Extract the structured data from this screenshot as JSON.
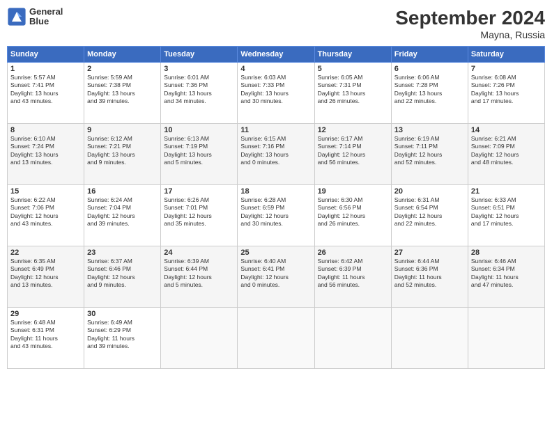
{
  "logo": {
    "line1": "General",
    "line2": "Blue"
  },
  "title": "September 2024",
  "subtitle": "Mayna, Russia",
  "weekdays": [
    "Sunday",
    "Monday",
    "Tuesday",
    "Wednesday",
    "Thursday",
    "Friday",
    "Saturday"
  ],
  "weeks": [
    [
      {
        "day": "1",
        "info": "Sunrise: 5:57 AM\nSunset: 7:41 PM\nDaylight: 13 hours\nand 43 minutes."
      },
      {
        "day": "2",
        "info": "Sunrise: 5:59 AM\nSunset: 7:38 PM\nDaylight: 13 hours\nand 39 minutes."
      },
      {
        "day": "3",
        "info": "Sunrise: 6:01 AM\nSunset: 7:36 PM\nDaylight: 13 hours\nand 34 minutes."
      },
      {
        "day": "4",
        "info": "Sunrise: 6:03 AM\nSunset: 7:33 PM\nDaylight: 13 hours\nand 30 minutes."
      },
      {
        "day": "5",
        "info": "Sunrise: 6:05 AM\nSunset: 7:31 PM\nDaylight: 13 hours\nand 26 minutes."
      },
      {
        "day": "6",
        "info": "Sunrise: 6:06 AM\nSunset: 7:28 PM\nDaylight: 13 hours\nand 22 minutes."
      },
      {
        "day": "7",
        "info": "Sunrise: 6:08 AM\nSunset: 7:26 PM\nDaylight: 13 hours\nand 17 minutes."
      }
    ],
    [
      {
        "day": "8",
        "info": "Sunrise: 6:10 AM\nSunset: 7:24 PM\nDaylight: 13 hours\nand 13 minutes."
      },
      {
        "day": "9",
        "info": "Sunrise: 6:12 AM\nSunset: 7:21 PM\nDaylight: 13 hours\nand 9 minutes."
      },
      {
        "day": "10",
        "info": "Sunrise: 6:13 AM\nSunset: 7:19 PM\nDaylight: 13 hours\nand 5 minutes."
      },
      {
        "day": "11",
        "info": "Sunrise: 6:15 AM\nSunset: 7:16 PM\nDaylight: 13 hours\nand 0 minutes."
      },
      {
        "day": "12",
        "info": "Sunrise: 6:17 AM\nSunset: 7:14 PM\nDaylight: 12 hours\nand 56 minutes."
      },
      {
        "day": "13",
        "info": "Sunrise: 6:19 AM\nSunset: 7:11 PM\nDaylight: 12 hours\nand 52 minutes."
      },
      {
        "day": "14",
        "info": "Sunrise: 6:21 AM\nSunset: 7:09 PM\nDaylight: 12 hours\nand 48 minutes."
      }
    ],
    [
      {
        "day": "15",
        "info": "Sunrise: 6:22 AM\nSunset: 7:06 PM\nDaylight: 12 hours\nand 43 minutes."
      },
      {
        "day": "16",
        "info": "Sunrise: 6:24 AM\nSunset: 7:04 PM\nDaylight: 12 hours\nand 39 minutes."
      },
      {
        "day": "17",
        "info": "Sunrise: 6:26 AM\nSunset: 7:01 PM\nDaylight: 12 hours\nand 35 minutes."
      },
      {
        "day": "18",
        "info": "Sunrise: 6:28 AM\nSunset: 6:59 PM\nDaylight: 12 hours\nand 30 minutes."
      },
      {
        "day": "19",
        "info": "Sunrise: 6:30 AM\nSunset: 6:56 PM\nDaylight: 12 hours\nand 26 minutes."
      },
      {
        "day": "20",
        "info": "Sunrise: 6:31 AM\nSunset: 6:54 PM\nDaylight: 12 hours\nand 22 minutes."
      },
      {
        "day": "21",
        "info": "Sunrise: 6:33 AM\nSunset: 6:51 PM\nDaylight: 12 hours\nand 17 minutes."
      }
    ],
    [
      {
        "day": "22",
        "info": "Sunrise: 6:35 AM\nSunset: 6:49 PM\nDaylight: 12 hours\nand 13 minutes."
      },
      {
        "day": "23",
        "info": "Sunrise: 6:37 AM\nSunset: 6:46 PM\nDaylight: 12 hours\nand 9 minutes."
      },
      {
        "day": "24",
        "info": "Sunrise: 6:39 AM\nSunset: 6:44 PM\nDaylight: 12 hours\nand 5 minutes."
      },
      {
        "day": "25",
        "info": "Sunrise: 6:40 AM\nSunset: 6:41 PM\nDaylight: 12 hours\nand 0 minutes."
      },
      {
        "day": "26",
        "info": "Sunrise: 6:42 AM\nSunset: 6:39 PM\nDaylight: 11 hours\nand 56 minutes."
      },
      {
        "day": "27",
        "info": "Sunrise: 6:44 AM\nSunset: 6:36 PM\nDaylight: 11 hours\nand 52 minutes."
      },
      {
        "day": "28",
        "info": "Sunrise: 6:46 AM\nSunset: 6:34 PM\nDaylight: 11 hours\nand 47 minutes."
      }
    ],
    [
      {
        "day": "29",
        "info": "Sunrise: 6:48 AM\nSunset: 6:31 PM\nDaylight: 11 hours\nand 43 minutes."
      },
      {
        "day": "30",
        "info": "Sunrise: 6:49 AM\nSunset: 6:29 PM\nDaylight: 11 hours\nand 39 minutes."
      },
      null,
      null,
      null,
      null,
      null
    ]
  ]
}
